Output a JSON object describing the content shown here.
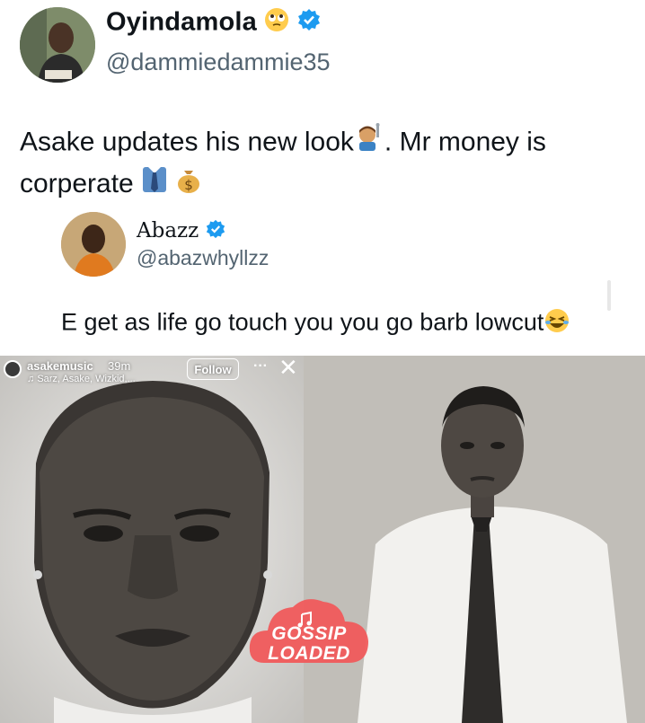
{
  "tweet": {
    "author": {
      "display_name": "Oyindamola",
      "handle": "@dammiedammie35"
    },
    "text_part1": "Asake updates his new look",
    "text_part2": ". Mr money is",
    "text_part3": "corperate"
  },
  "quote": {
    "author": {
      "display_name": "Abazz",
      "handle": "@abazwhyllzz"
    },
    "text": "E get as life go touch you you go barb lowcut"
  },
  "story": {
    "username": "asakemusic",
    "time": "39m",
    "music": "Sarz, Asake, Wizkid,...",
    "follow_label": "Follow",
    "more_label": "···",
    "close_label": "✕"
  },
  "watermark": {
    "line1": "GOSSIP",
    "line2": "LOADED"
  },
  "colors": {
    "verified": "#1d9bf0",
    "watermark": "#f05a5b"
  },
  "icons": [
    "verified-badge-icon",
    "rolling-eyes-emoji-icon",
    "haircut-emoji-icon",
    "necktie-emoji-icon",
    "money-bag-emoji-icon",
    "laughing-emoji-icon"
  ]
}
